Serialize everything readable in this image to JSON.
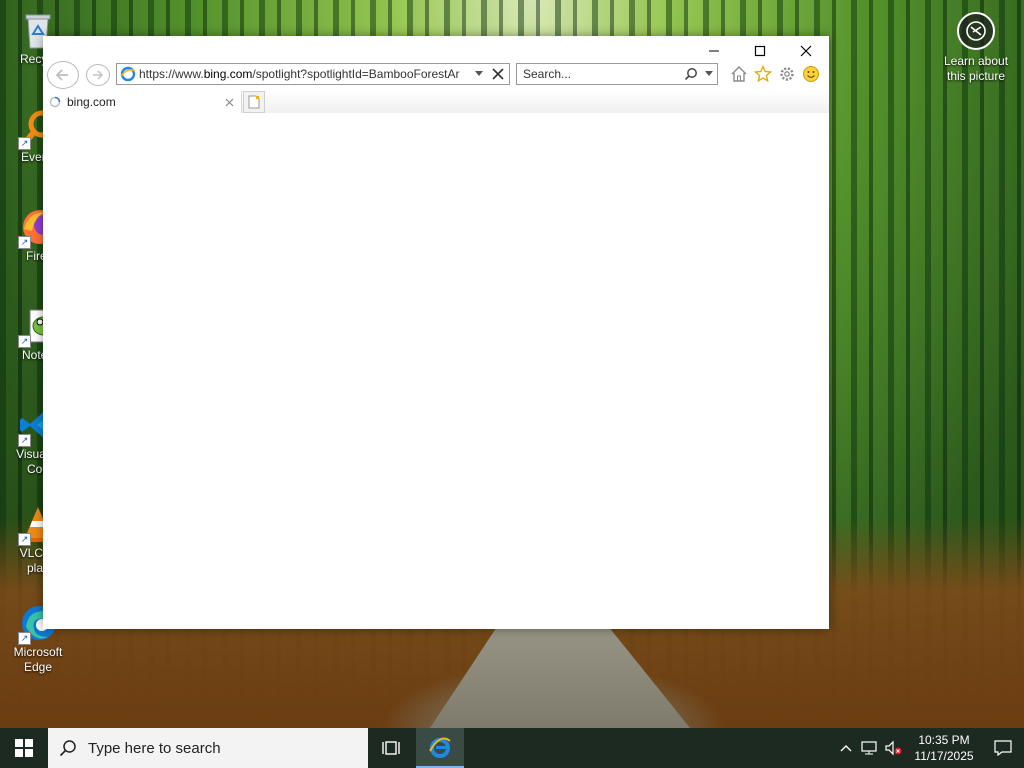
{
  "desktop": {
    "icons": [
      {
        "label": "Recycl",
        "icon": "recycle-bin-icon"
      },
      {
        "label": "Everyt",
        "icon": "everything-search-icon"
      },
      {
        "label": "Firef",
        "icon": "firefox-icon"
      },
      {
        "label": "Notep",
        "icon": "notepad-plus-plus-icon"
      },
      {
        "label": "Visual S",
        "label2": "Cod",
        "icon": "vscode-icon"
      },
      {
        "label": "VLC m",
        "label2": "play",
        "icon": "vlc-icon"
      },
      {
        "label": "Microsoft",
        "label2": "Edge",
        "icon": "edge-icon"
      }
    ],
    "learn": {
      "line1": "Learn about",
      "line2": "this picture"
    }
  },
  "browser": {
    "url_prefix": "https://www.",
    "url_domain": "bing.com",
    "url_rest": "/spotlight?spotlightId=BambooForestAr",
    "search_placeholder": "Search...",
    "tab_title": "bing.com"
  },
  "taskbar": {
    "search_placeholder": "Type here to search",
    "time": "10:35 PM",
    "date": "11/17/2025"
  },
  "colors": {
    "taskbar_bg": "#1c2a22",
    "ie_blue": "#1e88e5",
    "accent": "#76b9ed"
  }
}
